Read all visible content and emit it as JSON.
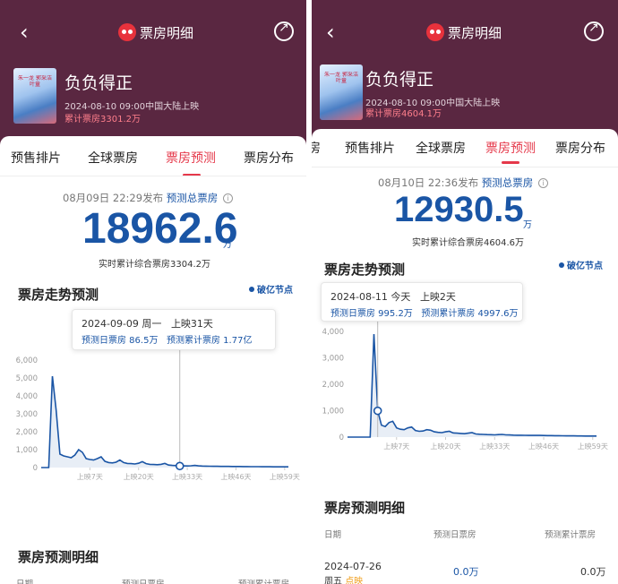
{
  "colors": {
    "header_bg": "#5a2741",
    "accent_red": "#e5384a",
    "accent_blue": "#1a55a5"
  },
  "left": {
    "nav": {
      "back_icon": "chevron-left-icon",
      "title": "票房明细",
      "logo_icon": "maoyan-logo-icon",
      "share_icon": "share-icon"
    },
    "movie": {
      "title": "负负得正",
      "meta": "2024-08-10 09:00中国大陆上映",
      "cumulative": "累计票房3301.2万",
      "poster_text": "朱一龙 郭采洁 叶童"
    },
    "tabs": [
      "预售排片",
      "全球票房",
      "票房预测",
      "票房分布"
    ],
    "active_tab": 2,
    "forecast": {
      "published": "08月09日 22:29发布",
      "label": "预测总票房",
      "total": "18962.6",
      "unit": "万",
      "realtime": "实时累计综合票房3304.2万"
    },
    "trend": {
      "title": "票房走势预测",
      "legend": "破亿节点",
      "tooltip": {
        "date": "2024-09-09 周一",
        "days": "上映31天",
        "daily": "预测日票房 86.5万",
        "total": "预测累计票房 1.77亿"
      }
    },
    "detail": {
      "title": "票房预测明细",
      "headers": [
        "日期",
        "预测日票房",
        "预测累计票房"
      ]
    }
  },
  "right": {
    "nav": {
      "back_icon": "chevron-left-icon",
      "title": "票房明细",
      "logo_icon": "maoyan-logo-icon",
      "share_icon": "share-icon"
    },
    "movie": {
      "title": "负负得正",
      "meta": "2024-08-10 09:00中国大陆上映",
      "cumulative": "累计票房4604.1万",
      "poster_text": "朱一龙 郭采洁 叶童"
    },
    "tabs": [
      "房",
      "预售排片",
      "全球票房",
      "票房预测",
      "票房分布"
    ],
    "active_tab": 3,
    "forecast": {
      "published": "08月10日 22:36发布",
      "label": "预测总票房",
      "total": "12930.5",
      "unit": "万",
      "realtime": "实时累计综合票房4604.6万"
    },
    "trend": {
      "title": "票房走势预测",
      "legend": "破亿节点",
      "tooltip": {
        "date": "2024-08-11 今天",
        "days": "上映2天",
        "daily": "预测日票房 995.2万",
        "total": "预测累计票房 4997.6万"
      }
    },
    "detail": {
      "title": "票房预测明细",
      "headers": [
        "日期",
        "预测日票房",
        "预测累计票房"
      ],
      "row": {
        "date": "2024-07-26",
        "weekday": "周五",
        "tag": "点映",
        "daily": "0.0万",
        "total": "0.0万"
      }
    },
    "watermark": "@"
  },
  "chart_data": [
    {
      "type": "line",
      "title": "票房走势预测",
      "xlabel": "",
      "ylabel": "",
      "x_ticks": [
        "上映7天",
        "上映20天",
        "上映33天",
        "上映46天",
        "上映59天"
      ],
      "y_ticks": [
        0,
        1000,
        2000,
        3000,
        4000,
        5000,
        6000
      ],
      "y_tick_labels": [
        "0",
        "1,000",
        "2,000",
        "3,000",
        "4,000",
        "5,000",
        "6,000"
      ],
      "ylim": [
        0,
        6000
      ],
      "x_range": [
        -6,
        60
      ],
      "x": [
        -6,
        -5,
        -4,
        -3,
        -2,
        -1,
        0,
        1,
        2,
        3,
        4,
        5,
        6,
        7,
        8,
        9,
        10,
        11,
        12,
        13,
        14,
        15,
        16,
        17,
        18,
        19,
        20,
        21,
        22,
        23,
        24,
        25,
        26,
        27,
        28,
        29,
        30,
        31,
        32,
        33,
        34,
        35,
        36,
        37,
        38,
        39,
        40,
        41,
        42,
        43,
        44,
        45,
        46,
        47,
        48,
        49,
        50,
        51,
        52,
        53,
        54,
        55,
        56,
        57,
        58,
        59,
        60
      ],
      "values": [
        0,
        0,
        0,
        5100,
        3200,
        750,
        650,
        600,
        550,
        700,
        1000,
        850,
        500,
        450,
        420,
        500,
        600,
        350,
        280,
        260,
        300,
        420,
        280,
        230,
        220,
        200,
        240,
        330,
        220,
        180,
        170,
        160,
        180,
        230,
        140,
        120,
        110,
        100,
        95,
        90,
        100,
        120,
        95,
        85,
        80,
        75,
        70,
        68,
        65,
        66,
        64,
        62,
        60,
        58,
        56,
        54,
        52,
        50,
        48,
        46,
        45,
        44,
        42,
        41,
        40,
        39,
        38
      ],
      "highlight": {
        "x": 31,
        "value": 86.5
      }
    },
    {
      "type": "line",
      "title": "票房走势预测",
      "xlabel": "",
      "ylabel": "",
      "x_ticks": [
        "上映7天",
        "上映20天",
        "上映33天",
        "上映46天",
        "上映59天"
      ],
      "y_ticks": [
        0,
        1000,
        2000,
        3000,
        4000
      ],
      "y_tick_labels": [
        "0",
        "1,000",
        "2,000",
        "3,000",
        "4,000"
      ],
      "ylim": [
        0,
        4000
      ],
      "x_range": [
        -6,
        60
      ],
      "x": [
        -6,
        -5,
        -4,
        -3,
        -2,
        -1,
        0,
        1,
        2,
        3,
        4,
        5,
        6,
        7,
        8,
        9,
        10,
        11,
        12,
        13,
        14,
        15,
        16,
        17,
        18,
        19,
        20,
        21,
        22,
        23,
        24,
        25,
        26,
        27,
        28,
        29,
        30,
        31,
        32,
        33,
        34,
        35,
        36,
        37,
        38,
        39,
        40,
        41,
        42,
        43,
        44,
        45,
        46,
        47,
        48,
        49,
        50,
        51,
        52,
        53,
        54,
        55,
        56,
        57,
        58,
        59,
        60
      ],
      "values": [
        0,
        0,
        0,
        0,
        0,
        0,
        0,
        3900,
        995,
        450,
        400,
        550,
        600,
        350,
        300,
        280,
        350,
        380,
        250,
        220,
        230,
        280,
        260,
        200,
        180,
        170,
        200,
        220,
        160,
        150,
        140,
        130,
        150,
        170,
        120,
        110,
        100,
        95,
        90,
        85,
        95,
        100,
        85,
        80,
        75,
        72,
        70,
        68,
        66,
        67,
        65,
        63,
        61,
        59,
        57,
        55,
        53,
        51,
        49,
        47,
        46,
        45,
        43,
        42,
        41,
        40,
        39
      ],
      "highlight": {
        "x": 2,
        "value": 995.2
      }
    }
  ]
}
